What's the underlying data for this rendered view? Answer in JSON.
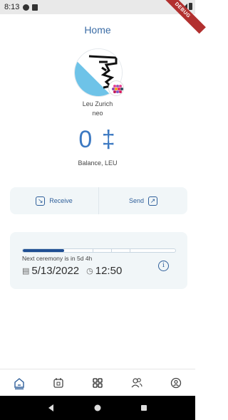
{
  "status_bar": {
    "time": "8:13"
  },
  "debug_banner": "DEBUG",
  "header": {
    "title": "Home"
  },
  "profile": {
    "name": "Leu Zurich",
    "handle": "neo"
  },
  "balance": {
    "amount": "0",
    "currency_symbol": "‡",
    "label": "Balance, LEU"
  },
  "actions": {
    "receive_label": "Receive",
    "send_label": "Send"
  },
  "ceremony": {
    "progress_fraction": 0.27,
    "next_text_prefix": "Next ceremony is in",
    "countdown": "5d 4h",
    "date": "5/13/2022",
    "time": "12:50"
  },
  "nav": {
    "items": [
      "home-icon",
      "wallet-icon",
      "qr-code-icon",
      "contacts-icon",
      "profile-icon"
    ],
    "active": "home-icon"
  },
  "colors": {
    "accent": "#3c79c2",
    "primary_dark": "#1f4f93",
    "card_bg": "#f1f6f8",
    "debug": "#b2302f"
  }
}
